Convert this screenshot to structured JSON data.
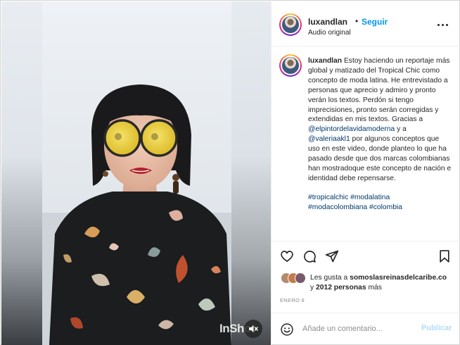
{
  "post": {
    "username": "luxandlan",
    "separator": "•",
    "follow_label": "Seguir",
    "audio_label": "Audio original",
    "more_icon": "more-horizontal-icon"
  },
  "caption": {
    "username": "luxandlan",
    "text_1": "Estoy haciendo un reportaje más global y matizado del Tropical Chic como concepto de moda latina. He entrevistado a personas que aprecio y admiro y pronto verán los textos. Perdón si tengo imprecisiones, pronto serán corregidas y extendidas en mis textos. Gracias a",
    "mention_1": "@elpintordelavidamoderna",
    "text_2": " y a",
    "mention_2": "@valeriaakl1",
    "text_3": " por algunos conceptos que uso en este video, donde planteo lo que ha pasado desde que dos marcas colombianas han mostradoque este concepto de nación e identidad debe repensarse.",
    "hashtags": [
      "#tropicalchic",
      "#modalatina",
      "#modacolombiana",
      "#colombia"
    ]
  },
  "actions": {
    "like_icon": "heart-icon",
    "comment_icon": "comment-icon",
    "share_icon": "share-icon",
    "save_icon": "bookmark-icon"
  },
  "likes": {
    "prefix": "Les gusta a ",
    "user": "somoslasreinasdelcaribe.co",
    "middle": "y ",
    "count": "2012 personas",
    "suffix": " más"
  },
  "date": "ENERO 8",
  "comment": {
    "placeholder": "Añade un comentario...",
    "publish_label": "Publicar",
    "emoji_icon": "emoji-icon"
  },
  "media": {
    "watermark": "InShot",
    "mute_icon": "speaker-muted-icon"
  },
  "colors": {
    "link_blue": "#0095f6",
    "mention_blue": "#00376b",
    "text": "#262626",
    "muted": "#8e8e8e",
    "border": "#efefef"
  }
}
